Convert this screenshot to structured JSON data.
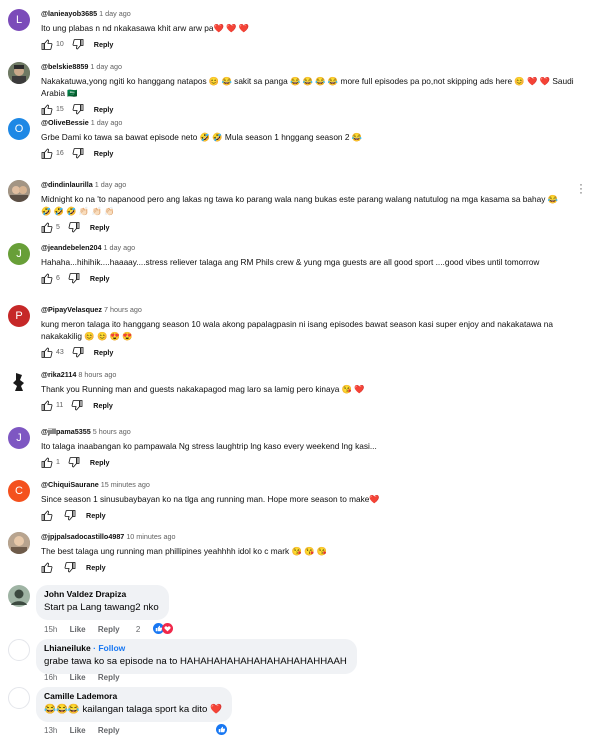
{
  "youtube_comments": [
    {
      "avatar_letter": "L",
      "avatar_color": "#7b4bb9",
      "user": "@lanieayob3685",
      "time": "1 day ago",
      "text": "Ito ung plabas n nd nkakasawa khit arw arw pa❤️ ❤️ ❤️",
      "likes": "10",
      "reply": "Reply"
    },
    {
      "avatar_letter": "",
      "avatar_color": "#8a8a7e",
      "user": "@belskie8859",
      "time": "1 day ago",
      "text": "Nakakatuwa,yong ngiti ko hanggang natapos 😊 😂 sakit sa panga 😂 😂 😂 😂  more full episodes pa po,not skipping ads here 😊 ❤️ ❤️  Saudi Arabia 🇸🇦",
      "likes": "15",
      "reply": "Reply"
    },
    {
      "avatar_letter": "O",
      "avatar_color": "#1e88e5",
      "user": "@OliveBessie",
      "time": "1 day ago",
      "text": "Grbe Dami ko tawa sa bawat episode neto 🤣 🤣  Mula season 1 hnggang season 2 😂",
      "likes": "16",
      "reply": "Reply"
    },
    {
      "avatar_letter": "",
      "avatar_color": "#9a8878",
      "user": "@dindinlaurilla",
      "time": "1 day ago",
      "text": "Midnight ko na 'to napanood pero ang lakas ng tawa ko parang wala nang bukas este parang walang natutulog na mga kasama sa bahay 😂 🤣 🤣 🤣 👏🏻 👏🏻 👏🏻",
      "likes": "5",
      "reply": "Reply"
    },
    {
      "avatar_letter": "J",
      "avatar_color": "#689f38",
      "user": "@jeandebelen204",
      "time": "1 day ago",
      "text": "Hahaha...hihihik....haaaay....stress reliever talaga ang RM Phils crew & yung mga  guests are all good sport ....good vibes until tomorrow",
      "likes": "6",
      "reply": "Reply"
    },
    {
      "avatar_letter": "P",
      "avatar_color": "#c62828",
      "user": "@PipayVelasquez",
      "time": "7 hours ago",
      "text": "kung meron talaga ito hanggang season 10 wala akong papalagpasin ni isang episodes bawat season kasi super enjoy and nakakatawa na nakakakilig 😊 😊 😍 😍",
      "likes": "43",
      "reply": "Reply"
    },
    {
      "avatar_letter": "",
      "avatar_color": "#ffffff",
      "user": "@rika2114",
      "time": "8 hours ago",
      "text": "Thank you Running man and guests nakakapagod mag laro sa lamig pero kinaya 😘 ❤️",
      "likes": "11",
      "reply": "Reply"
    },
    {
      "avatar_letter": "J",
      "avatar_color": "#7e57c2",
      "user": "@jillpama5355",
      "time": "5 hours ago",
      "text": "Ito talaga inaabangan ko pampawala Ng stress laughtrip lng kaso every weekend lng kasi...",
      "likes": "1",
      "reply": "Reply"
    },
    {
      "avatar_letter": "C",
      "avatar_color": "#f4511e",
      "user": "@ChiquiSaurane",
      "time": "15 minutes ago",
      "text": "Since season 1 sinusubaybayan ko na tlga ang running man. Hope more season to make❤️",
      "likes": "",
      "reply": "Reply"
    },
    {
      "avatar_letter": "",
      "avatar_color": "#8d7b6a",
      "user": "@jpjpalsadocastillo4987",
      "time": "10 minutes ago",
      "text": "The best talaga ung running man phillipines yeahhhh idol ko c mark 😘 😘 😘",
      "likes": "",
      "reply": "Reply"
    }
  ],
  "facebook_comments": [
    {
      "name": "John Valdez Drapiza",
      "follow": "",
      "text": "Start pa Lang tawang2 nko",
      "time": "15h",
      "like": "Like",
      "reply": "Reply",
      "reactions": "2"
    },
    {
      "name": "Lhianeiluke",
      "follow": "· Follow",
      "text": "grabe tawa ko sa episode na to HAHAHAHAHAHAHAHAHAHAHHAAH",
      "time": "16h",
      "like": "Like",
      "reply": "Reply",
      "reactions": ""
    },
    {
      "name": "Camille Lademora",
      "follow": "",
      "text": "😂😂😂 kailangan talaga sport ka dito ❤️",
      "time": "13h",
      "like": "Like",
      "reply": "Reply",
      "reactions": ""
    }
  ],
  "icons": {
    "like": "thumbs-up-icon",
    "dislike": "thumbs-down-icon",
    "more": "more-vert-icon"
  },
  "colors": {
    "fb_link": "#1877f2",
    "fb_bubble": "#f0f2f5",
    "yt_meta": "#606060"
  }
}
